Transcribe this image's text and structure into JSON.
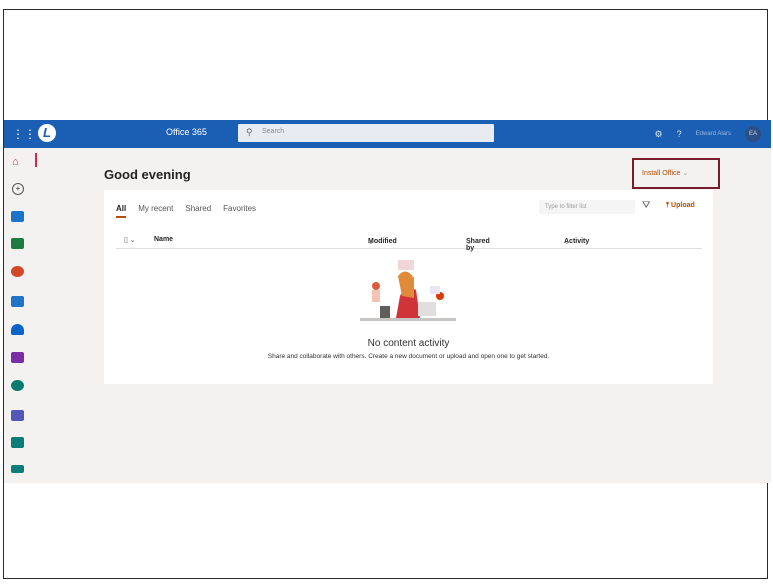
{
  "topbar": {
    "app_title": "Office 365",
    "search_placeholder": "Search",
    "settings_icon": "gear-icon",
    "help_label": "?",
    "user_name": "Edward Alars",
    "avatar_initials": "EA"
  },
  "rail": {
    "icons": [
      "home-icon",
      "create-icon",
      "outlook-icon",
      "excel-icon",
      "powerpoint-icon",
      "outlook-mail-icon",
      "onedrive-icon",
      "onenote-icon",
      "sharepoint-icon",
      "teams-icon",
      "sway-icon",
      "forms-icon"
    ]
  },
  "main": {
    "greeting": "Good evening",
    "install_label": "Install Office",
    "tabs": [
      "All",
      "My recent",
      "Shared",
      "Favorites"
    ],
    "filter_placeholder": "Type to filter list",
    "upload_label": "Upload",
    "columns": {
      "name": "Name",
      "modified": "Modified",
      "shared_by": "Shared by",
      "activity": "Activity"
    },
    "empty_title": "No content activity",
    "empty_desc": "Share and collaborate with others. Create a new document or upload and open one to get started."
  },
  "colors": {
    "topbar": "#1b5fb4",
    "accent": "#b64d00",
    "highlight_box": "#7a1c2b"
  }
}
